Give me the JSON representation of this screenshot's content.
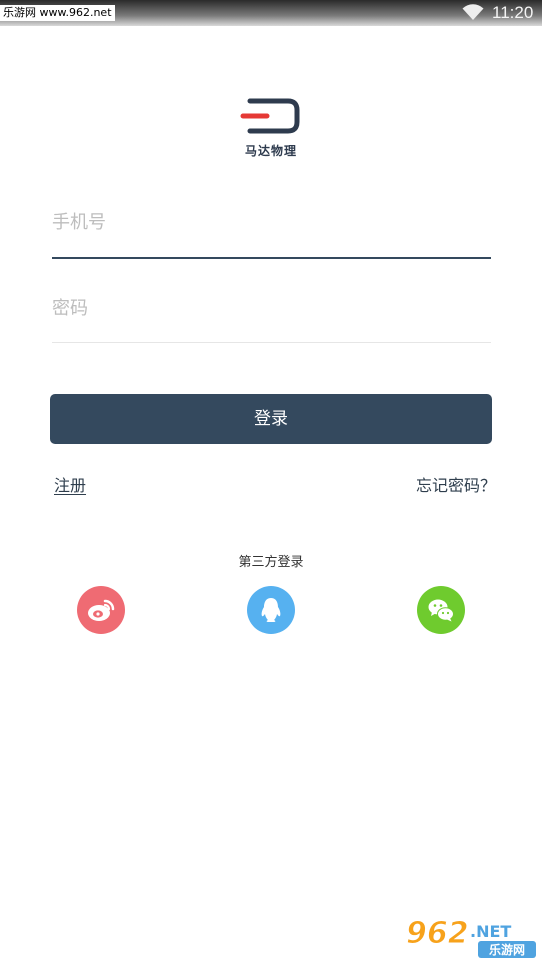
{
  "status_bar": {
    "watermark": "乐游网 www.962.net",
    "time": "11:20"
  },
  "app": {
    "brand": "马达物理"
  },
  "form": {
    "phone_placeholder": "手机号",
    "password_placeholder": "密码",
    "login_label": "登录",
    "register_label": "注册",
    "forgot_label": "忘记密码？"
  },
  "third_party": {
    "label": "第三方登录",
    "providers": [
      {
        "icon": "weibo-icon",
        "color": "#ef6b73"
      },
      {
        "icon": "qq-icon",
        "color": "#56b1f0"
      },
      {
        "icon": "wechat-icon",
        "color": "#6fcb2e"
      }
    ]
  },
  "watermark_bottom": {
    "number": "962",
    "suffix": ".NET",
    "name": "乐游网"
  },
  "colors": {
    "primary": "#34495e",
    "accent_red": "#e53935"
  }
}
